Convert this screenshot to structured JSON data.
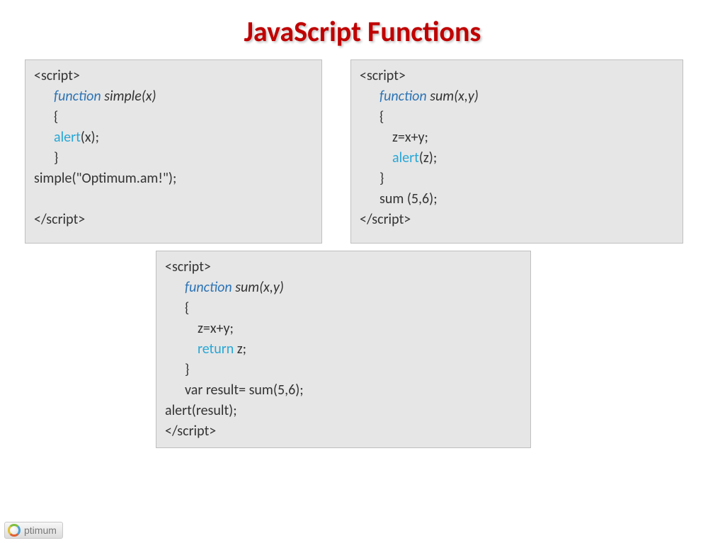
{
  "title": "JavaScript Functions",
  "box1": {
    "open": "<script>",
    "l1_kw": "function",
    "l1_rest": " simple(x)",
    "l2": "{",
    "l3_call": "alert",
    "l3_rest": "(x);",
    "l4": "}",
    "l5": "simple(\"Optimum.am!\");",
    "close": "</script>"
  },
  "box2": {
    "open": "<script>",
    "l1_kw": "function",
    "l1_rest": " sum(x,y)",
    "l2": "{",
    "l3": "z=x+y;",
    "l4_call": "alert",
    "l4_rest": "(z);",
    "l5": "}",
    "l6": "sum (5,6);",
    "close": "</script>"
  },
  "box3": {
    "open": "<script>",
    "l1_kw": "function",
    "l1_rest": " sum(x,y)",
    "l2": "{",
    "l3": "z=x+y;",
    "l4_kw": "return",
    "l4_rest": " z;",
    "l5": "}",
    "l6": "var  result= sum(5,6);",
    "l7": "alert(result);",
    "close": "</script>"
  },
  "logo_text": "ptimum"
}
